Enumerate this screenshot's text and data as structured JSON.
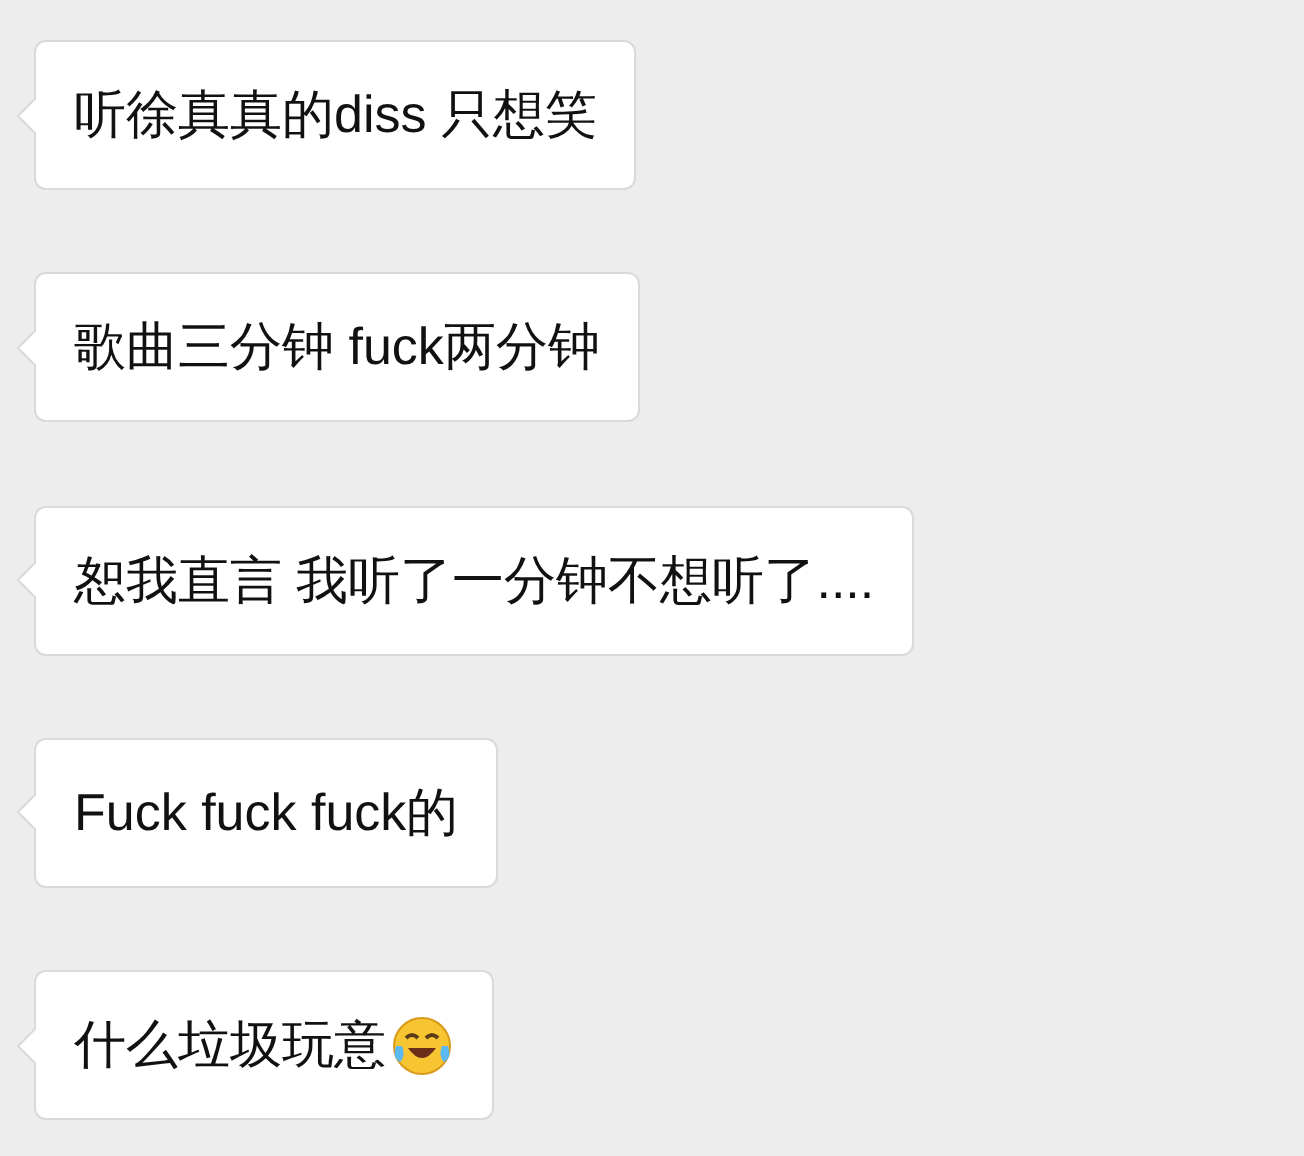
{
  "messages": [
    {
      "kind": "text",
      "text": "听徐真真的diss 只想笑"
    },
    {
      "kind": "text",
      "text": "歌曲三分钟 fuck两分钟"
    },
    {
      "kind": "text",
      "text": "恕我直言 我听了一分钟不想听了...."
    },
    {
      "kind": "text",
      "text": "Fuck fuck fuck的"
    },
    {
      "kind": "emoji",
      "text": "什么垃圾玩意"
    }
  ]
}
